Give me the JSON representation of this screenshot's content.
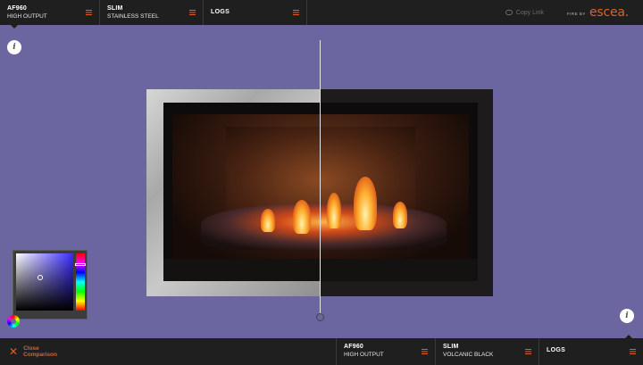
{
  "top": {
    "segments": [
      {
        "title": "AF960",
        "subtitle": "HIGH OUTPUT"
      },
      {
        "title": "SLIM",
        "subtitle": "STAINLESS STEEL"
      },
      {
        "title": "LOGS"
      }
    ],
    "copy_link": "Copy Link",
    "brand_prefix": "FIRE BY",
    "brand_logo": "escea."
  },
  "bottom": {
    "close_label": "Close Comparison",
    "segments": [
      {
        "title": "AF960",
        "subtitle": "HIGH OUTPUT"
      },
      {
        "title": "SLIM",
        "subtitle": "VOLCANIC BLACK"
      },
      {
        "title": "LOGS"
      }
    ]
  },
  "info_label": "i",
  "colors": {
    "background": "#6b66a0",
    "accent": "#e0602a",
    "bar": "#1f1f1f"
  },
  "icons": [
    "menu-icon",
    "link-icon",
    "info-icon",
    "close-icon",
    "color-wheel-icon"
  ]
}
